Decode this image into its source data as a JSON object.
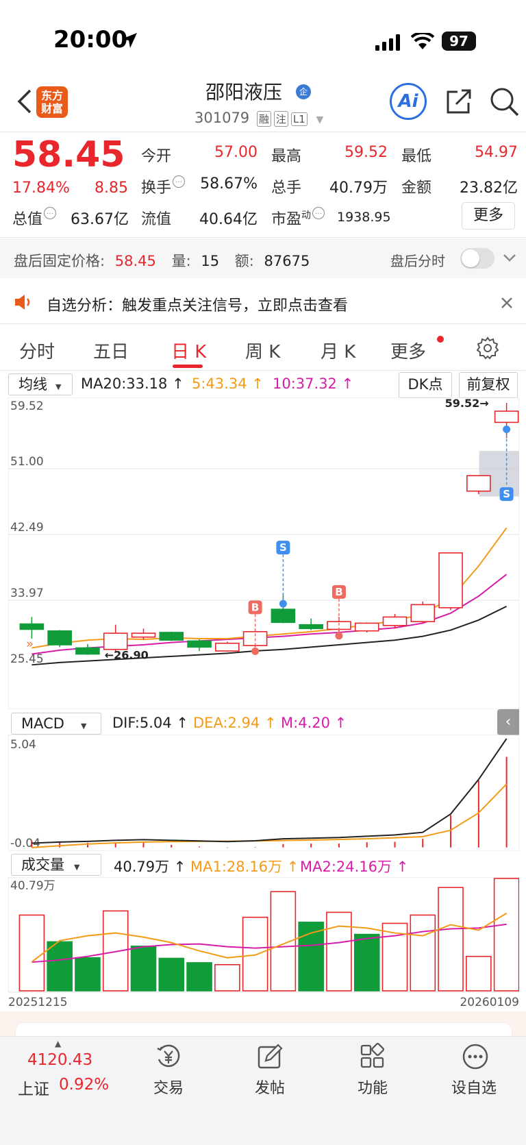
{
  "status_bar": {
    "time": "20:00",
    "battery": "97"
  },
  "header": {
    "logo_line1": "东方",
    "logo_line2": "财富",
    "stock_name": "邵阳液压",
    "badge": "企",
    "stock_code": "301079",
    "tags": [
      "融",
      "注",
      "L1"
    ],
    "ai_label": "Ai"
  },
  "quote": {
    "price": "58.45",
    "change_pct": "17.84%",
    "change_amt": "8.85",
    "open_label": "今开",
    "open_value": "57.00",
    "high_label": "最高",
    "high_value": "59.52",
    "low_label": "最低",
    "low_value": "54.97",
    "turnover_label": "换手",
    "turnover_value": "58.67%",
    "volume_label": "总手",
    "volume_value": "40.79万",
    "amount_label": "金额",
    "amount_value": "23.82亿",
    "mktcap_label": "总值",
    "mktcap_value": "63.67亿",
    "float_label": "流值",
    "float_value": "40.64亿",
    "pe_label": "市盈",
    "pe_sup": "动",
    "pe_value": "1938.95",
    "more_label": "更多"
  },
  "after_hours": {
    "price_label": "盘后固定价格:",
    "price_value": "58.45",
    "vol_label": "量:",
    "vol_value": "15",
    "amt_label": "额:",
    "amt_value": "87675",
    "timeshare_label": "盘后分时"
  },
  "notice": {
    "text": "自选分析：触发重点关注信号，立即点击查看"
  },
  "tabs": [
    "分时",
    "五日",
    "日 K",
    "周 K",
    "月 K",
    "更多"
  ],
  "ma_row": {
    "selector": "均线",
    "ma20": "MA20:33.18",
    "ma5": "5:43.34",
    "ma10": "10:37.32",
    "dk_label": "DK点",
    "fq_label": "前复权"
  },
  "macd_row": {
    "selector": "MACD",
    "dif": "DIF:5.04",
    "dea": "DEA:2.94",
    "m": "M:4.20"
  },
  "vol_row": {
    "selector": "成交量",
    "vol": "40.79万",
    "ma1": "MA1:28.16万",
    "ma2": "MA2:24.16万"
  },
  "colors": {
    "up": "#e8262b",
    "down": "#119c3a",
    "ma5": "#f39b16",
    "ma10": "#d61ca8",
    "ma20": "#222222"
  },
  "chart_data": [
    {
      "type": "candlestick",
      "y_ticks": [
        "59.52",
        "51.00",
        "42.49",
        "33.97",
        "25.45"
      ],
      "ylim": [
        25.45,
        59.52
      ],
      "high_annotation": "59.52→",
      "low_annotation": "←26.90",
      "candles": [
        {
          "o": 30.9,
          "c": 30.2,
          "h": 31.8,
          "l": 29.0
        },
        {
          "o": 30.0,
          "c": 28.2,
          "h": 30.1,
          "l": 27.9
        },
        {
          "o": 27.8,
          "c": 27.0,
          "h": 28.3,
          "l": 26.9
        },
        {
          "o": 27.6,
          "c": 29.7,
          "h": 30.8,
          "l": 27.3
        },
        {
          "o": 29.2,
          "c": 29.7,
          "h": 30.3,
          "l": 28.9
        },
        {
          "o": 29.8,
          "c": 28.8,
          "h": 29.9,
          "l": 28.7
        },
        {
          "o": 28.7,
          "c": 27.9,
          "h": 28.9,
          "l": 27.4
        },
        {
          "o": 27.4,
          "c": 28.4,
          "h": 28.6,
          "l": 27.3
        },
        {
          "o": 28.1,
          "c": 29.9,
          "h": 30.3,
          "l": 27.9
        },
        {
          "o": 32.8,
          "c": 31.1,
          "h": 34.8,
          "l": 31.0
        },
        {
          "o": 30.8,
          "c": 30.3,
          "h": 31.6,
          "l": 30.1
        },
        {
          "o": 30.2,
          "c": 31.2,
          "h": 31.8,
          "l": 29.9
        },
        {
          "o": 30.0,
          "c": 31.0,
          "h": 31.1,
          "l": 29.8
        },
        {
          "o": 30.7,
          "c": 31.8,
          "h": 32.2,
          "l": 30.3
        },
        {
          "o": 31.2,
          "c": 33.4,
          "h": 33.8,
          "l": 31.0
        },
        {
          "o": 33.0,
          "c": 40.1,
          "h": 40.1,
          "l": 32.7
        },
        {
          "o": 48.1,
          "c": 50.1,
          "h": 50.1,
          "l": 47.7
        },
        {
          "o": 57.0,
          "c": 58.45,
          "h": 59.52,
          "l": 54.97
        }
      ],
      "ma5": [
        27.8,
        28.4,
        28.8,
        29.0,
        28.9,
        29.1,
        29.0,
        29.0,
        29.3,
        29.6,
        29.9,
        30.3,
        30.8,
        31.3,
        32.2,
        34.2,
        38.4,
        43.34
      ],
      "ma10": [
        27.0,
        27.5,
        27.8,
        28.0,
        28.2,
        28.5,
        28.7,
        28.9,
        29.1,
        29.3,
        29.6,
        29.8,
        30.1,
        30.4,
        31.0,
        32.3,
        34.5,
        37.32
      ],
      "ma20": [
        25.6,
        25.9,
        26.1,
        26.3,
        26.5,
        26.7,
        26.9,
        27.1,
        27.4,
        27.6,
        27.9,
        28.2,
        28.5,
        28.8,
        29.3,
        30.1,
        31.4,
        33.18
      ],
      "signals": [
        {
          "index": 8,
          "label": "B"
        },
        {
          "index": 9,
          "label": "S"
        },
        {
          "index": 11,
          "label": "B"
        },
        {
          "index": 17,
          "label": "S"
        }
      ]
    },
    {
      "type": "line",
      "name": "MACD",
      "y_ticks": [
        "5.04",
        "-0.04"
      ],
      "ylim": [
        -0.04,
        5.04
      ],
      "dif": [
        0.2,
        0.25,
        0.28,
        0.33,
        0.36,
        0.33,
        0.3,
        0.27,
        0.31,
        0.4,
        0.43,
        0.46,
        0.52,
        0.58,
        0.7,
        1.55,
        3.15,
        5.04
      ],
      "dea": [
        -0.01,
        0.08,
        0.16,
        0.21,
        0.25,
        0.27,
        0.28,
        0.29,
        0.3,
        0.32,
        0.34,
        0.37,
        0.4,
        0.45,
        0.5,
        0.8,
        1.6,
        2.94
      ],
      "m": [
        0.3,
        0.28,
        0.22,
        0.24,
        0.22,
        0.12,
        0.04,
        -0.02,
        0.02,
        0.16,
        0.18,
        0.18,
        0.24,
        0.26,
        0.4,
        1.5,
        3.1,
        4.2
      ]
    },
    {
      "type": "bar",
      "name": "成交量",
      "y_ticks": [
        "40.79万"
      ],
      "x_ticks": [
        "20251215",
        "20260109"
      ],
      "ylim": [
        0,
        40.79
      ],
      "up": [
        true,
        false,
        false,
        true,
        false,
        false,
        false,
        true,
        true,
        true,
        false,
        true,
        false,
        true,
        true,
        true,
        true,
        true
      ],
      "values": [
        27.5,
        17.8,
        12.0,
        29.0,
        16.2,
        11.8,
        10.2,
        9.5,
        26.7,
        36.0,
        24.9,
        28.5,
        20.5,
        24.5,
        27.5,
        37.5,
        12.5,
        40.79
      ],
      "ma1": [
        10.5,
        18.2,
        20.0,
        21.0,
        19.5,
        17.5,
        14.5,
        12.0,
        13.0,
        17.0,
        21.0,
        23.5,
        22.8,
        21.0,
        20.0,
        24.0,
        22.0,
        28.16
      ],
      "ma2": [
        10.4,
        11.2,
        12.5,
        14.2,
        16.0,
        16.8,
        17.0,
        16.0,
        15.5,
        16.0,
        16.5,
        17.5,
        19.0,
        20.0,
        21.5,
        22.5,
        22.8,
        24.16
      ]
    }
  ],
  "bottom_nav": {
    "index_value": "4120.43",
    "index_name": "上证",
    "index_pct": "0.92%",
    "items": [
      "交易",
      "发帖",
      "功能",
      "设自选"
    ]
  }
}
